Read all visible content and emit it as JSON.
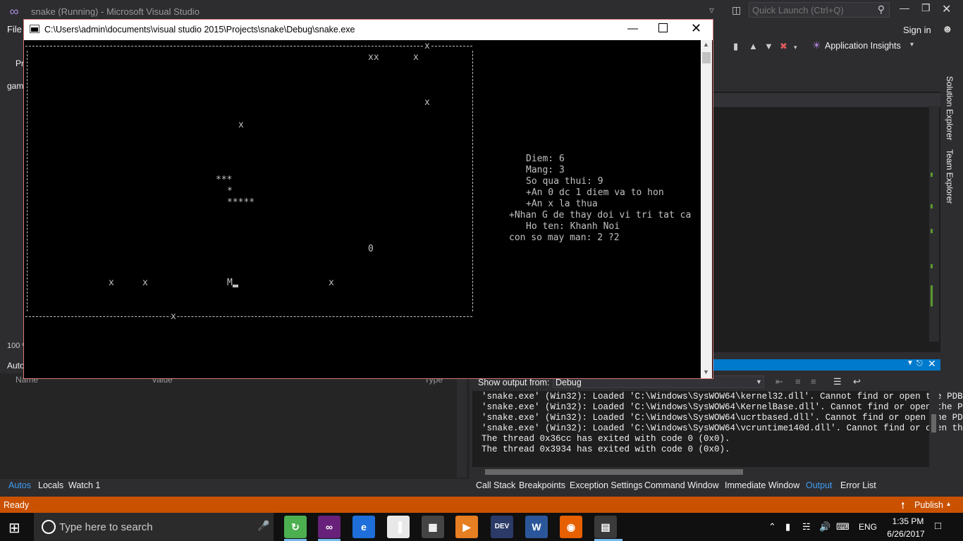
{
  "vs": {
    "title": "snake (Running) - Microsoft Visual Studio",
    "quick_launch_placeholder": "Quick Launch (Ctrl+Q)",
    "menu_file": "File",
    "sign_in": "Sign in",
    "app_insights": "Application Insights",
    "left_fragments": {
      "pr": "Pr",
      "gam": "gam",
      "zoom": "100 %",
      "autos": "Autos"
    }
  },
  "console": {
    "title": "C:\\Users\\admin\\documents\\visual studio 2015\\Projects\\snake\\Debug\\snake.exe",
    "board": {
      "top_x": "x",
      "bottom_x": "x",
      "items": {
        "xx1": "xx",
        "x1": "x",
        "x2": "x",
        "x3": "x",
        "snake1": "***",
        "snake2": "*",
        "snake3": "*****",
        "zero": "0",
        "xb1": "x",
        "xb2": "x",
        "m": "M",
        "xb3": "x"
      }
    },
    "info": {
      "diem": "Diem: 6",
      "mang": "Mang: 3",
      "so_qua": "So qua thui: 9",
      "rule1": "+An 0 dc 1 diem va to hon",
      "rule2": "+An x la thua",
      "rule3": "+Nhan G de thay doi vi tri tat ca",
      "ho_ten": "Ho ten: Khanh Noi",
      "may_man": "con so may man: 2 ?2"
    }
  },
  "autos": {
    "headers": [
      "Name",
      "Value",
      "Type"
    ]
  },
  "bottom_tabs_left": [
    "Autos",
    "Locals",
    "Watch 1"
  ],
  "bottom_tabs_right": [
    "Call Stack",
    "Breakpoints",
    "Exception Settings",
    "Command Window",
    "Immediate Window",
    "Output",
    "Error List"
  ],
  "output": {
    "label": "Show output from:",
    "source": "Debug",
    "lines": [
      "'snake.exe' (Win32): Loaded 'C:\\Windows\\SysWOW64\\kernel32.dll'. Cannot find or open the PDB",
      "'snake.exe' (Win32): Loaded 'C:\\Windows\\SysWOW64\\KernelBase.dll'. Cannot find or open the P",
      "'snake.exe' (Win32): Loaded 'C:\\Windows\\SysWOW64\\ucrtbased.dll'. Cannot find or open the PD",
      "'snake.exe' (Win32): Loaded 'C:\\Windows\\SysWOW64\\vcruntime140d.dll'. Cannot find or open th",
      "The thread 0x36cc has exited with code 0 (0x0).",
      "The thread 0x3934 has exited with code 0 (0x0)."
    ]
  },
  "status": {
    "text": "Ready",
    "publish": "Publish"
  },
  "taskbar": {
    "search_placeholder": "Type here to search",
    "apps": [
      {
        "label": "↻",
        "color": "#4caf50"
      },
      {
        "label": "∞",
        "color": "#68217a"
      },
      {
        "label": "e",
        "color": "#1e6fd9"
      },
      {
        "label": "▐",
        "color": "#e8e8e8"
      },
      {
        "label": "▦",
        "color": "#444"
      },
      {
        "label": "▶",
        "color": "#e67e22"
      },
      {
        "label": "DEV",
        "color": "#2b3a67"
      },
      {
        "label": "W",
        "color": "#2b579a"
      },
      {
        "label": "◉",
        "color": "#e66000"
      },
      {
        "label": "▤",
        "color": "#3a3a3a"
      }
    ],
    "lang": "ENG",
    "time": "1:35 PM",
    "date": "6/26/2017"
  }
}
